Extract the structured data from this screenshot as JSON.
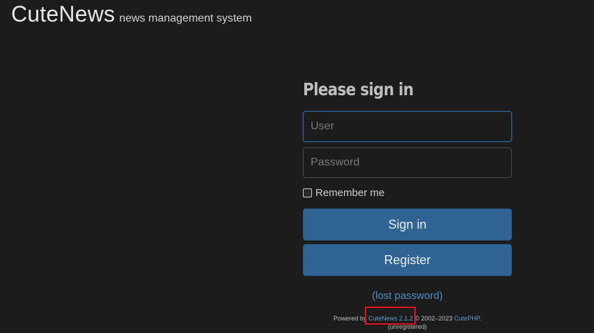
{
  "header": {
    "brand": "CuteNews",
    "tagline": "news management system"
  },
  "login": {
    "title": "Please sign in",
    "user_placeholder": "User",
    "password_placeholder": "Password",
    "remember_label": "Remember me",
    "remember_checked": false,
    "signin_label": "Sign in",
    "register_label": "Register",
    "lost_password_label": "(lost password)"
  },
  "footer": {
    "powered_by": "Powered by",
    "product_link": "CuteNews 2.1.2",
    "copyright": "© 2002–2023",
    "company_link": "CutePHP",
    "period": ".",
    "license_status": "(unregistered)"
  },
  "colors": {
    "background": "#1c1c1d",
    "button": "#2e6394",
    "link": "#4f8fc4",
    "highlight_box": "#e0141b"
  }
}
